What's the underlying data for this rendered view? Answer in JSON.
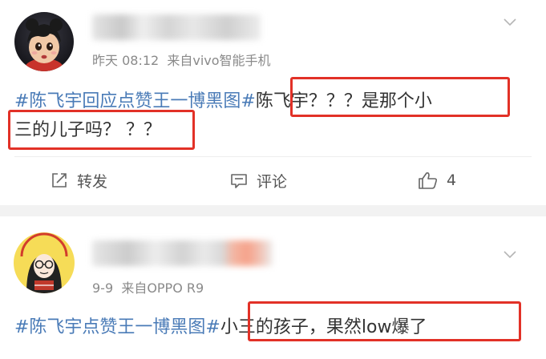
{
  "posts": [
    {
      "time": "昨天 08:12",
      "source": "来自vivo智能手机",
      "content_line1_topic": "#陈飞宇回应点赞王一博黑图#",
      "content_line1_text": "陈飞宇？？？是那个小",
      "content_line2_text": "三的儿子吗？ ？？",
      "actions": {
        "repost": "转发",
        "comment": "评论",
        "like_count": "4"
      }
    },
    {
      "time": "9-9",
      "source": "来自OPPO R9",
      "content_line1_topic": "#陈飞宇点赞王一博黑图#",
      "content_line1_text": "小三的孩子，果然low爆了"
    }
  ],
  "colors": {
    "topic": "#4a7bb7",
    "highlight_box": "#e23127",
    "meta": "#8a8a8a",
    "separator": "#f2f2f2"
  },
  "icons": [
    "chevron-down-icon",
    "repost-icon",
    "comment-icon",
    "like-icon"
  ]
}
